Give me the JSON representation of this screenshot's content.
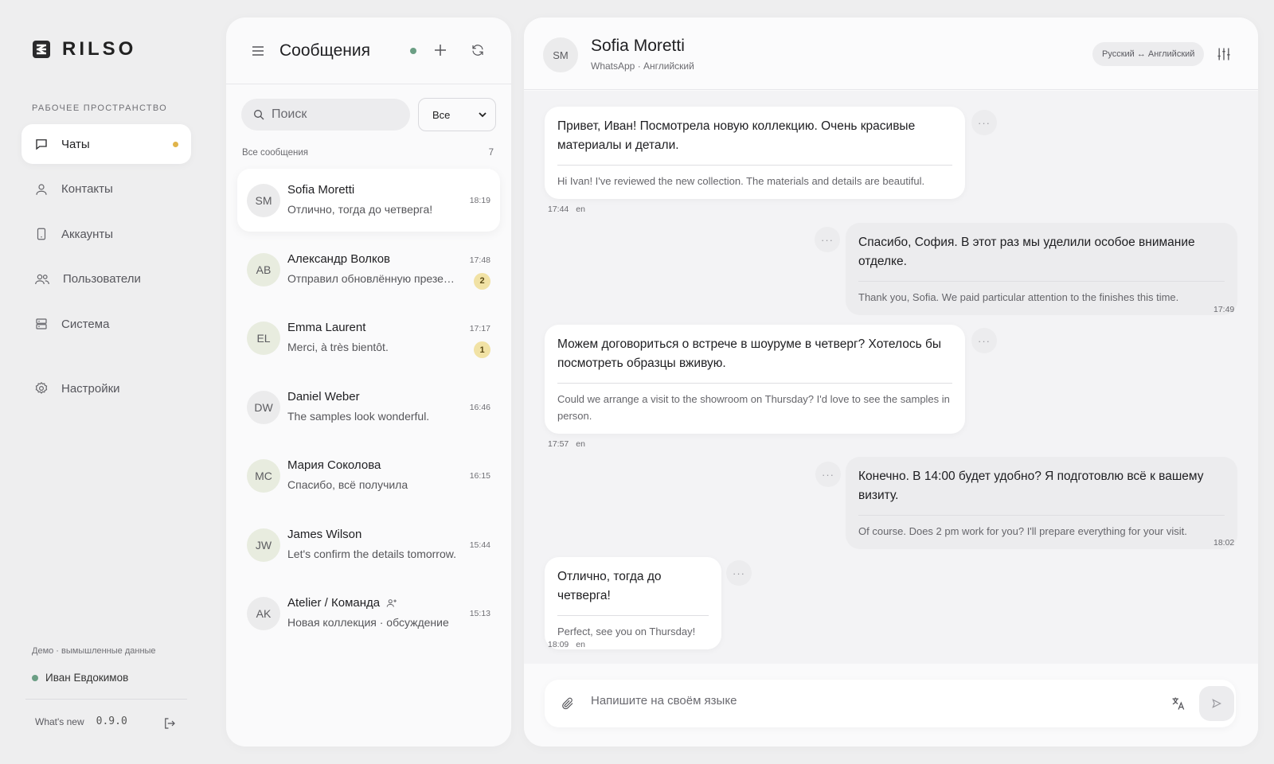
{
  "brand": {
    "name": "RILSO"
  },
  "nav": {
    "section_label": "РАБОЧЕЕ ПРОСТРАНСТВО",
    "items": [
      {
        "label": "Чаты",
        "icon": "chat-bubble-icon",
        "active": true,
        "has_dot": true
      },
      {
        "label": "Контакты",
        "icon": "person-icon"
      },
      {
        "label": "Аккаунты",
        "icon": "phone-icon"
      },
      {
        "label": "Пользователи",
        "icon": "users-icon"
      },
      {
        "label": "Система",
        "icon": "server-icon"
      }
    ],
    "settings_label": "Настройки",
    "demo_note": "Демо · вымышленные данные",
    "user_name": "Иван Евдокимов",
    "whats_new": "What's new",
    "version": "0.9.0"
  },
  "list": {
    "title": "Сообщения",
    "search_placeholder": "Поиск",
    "filter_value": "Все",
    "section_label": "Все сообщения",
    "section_count": "7",
    "conversations": [
      {
        "initials": "SM",
        "name": "Sofia Moretti",
        "preview": "Отлично, тогда до четверга!",
        "time": "18:19",
        "unread": ""
      },
      {
        "initials": "AB",
        "name": "Александр Волков",
        "preview": "Отправил обновлённую презентацию",
        "time": "17:48",
        "unread": "2"
      },
      {
        "initials": "EL",
        "name": "Emma Laurent",
        "preview": "Merci, à très bientôt.",
        "time": "17:17",
        "unread": "1"
      },
      {
        "initials": "DW",
        "name": "Daniel Weber",
        "preview": "The samples look wonderful.",
        "time": "16:46",
        "unread": ""
      },
      {
        "initials": "MC",
        "name": "Мария Соколова",
        "preview": "Спасибо, всё получила",
        "time": "16:15",
        "unread": ""
      },
      {
        "initials": "JW",
        "name": "James Wilson",
        "preview": "Let's confirm the details tomorrow.",
        "time": "15:44",
        "unread": ""
      },
      {
        "initials": "AK",
        "name": "Atelier / Команда",
        "preview": "Новая коллекция · обсуждение",
        "time": "15:13",
        "unread": "",
        "group": true
      }
    ]
  },
  "chat": {
    "initials": "SM",
    "name": "Sofia Moretti",
    "subtitle": "WhatsApp · Английский",
    "language_pair": "Русский ↔ Английский",
    "messages": [
      {
        "direction": "in",
        "original": "Привет, Иван! Посмотрела новую коллекцию. Очень красивые материалы и детали.",
        "translation": "Hi Ivan! I've reviewed the new collection. The materials and details are beautiful.",
        "time": "17:44",
        "lang": "en"
      },
      {
        "direction": "out",
        "original": "Спасибо, София. В этот раз мы уделили особое внимание отделке.",
        "translation": "Thank you, Sofia. We paid particular attention to the finishes this time.",
        "time": "17:49",
        "lang": ""
      },
      {
        "direction": "in",
        "original": "Можем договориться о встрече в шоуруме в четверг? Хотелось бы посмотреть образцы вживую.",
        "translation": "Could we arrange a visit to the showroom on Thursday? I'd love to see the samples in person.",
        "time": "17:57",
        "lang": "en"
      },
      {
        "direction": "out",
        "original": "Конечно. В 14:00 будет удобно? Я подготовлю всё к вашему визиту.",
        "translation": "Of course. Does 2 pm work for you? I'll prepare everything for your visit.",
        "time": "18:02",
        "lang": ""
      },
      {
        "direction": "in",
        "original": "Отлично, тогда до четверга!",
        "translation": "Perfect, see you on Thursday!",
        "time": "18:09",
        "lang": "en"
      }
    ],
    "more_label": "···",
    "composer_placeholder": "Напишите на своём языке"
  },
  "colors": {
    "accent_dot": "#e0b44b",
    "online": "#6b9e84",
    "unread_badge": "#f1e2a5"
  }
}
